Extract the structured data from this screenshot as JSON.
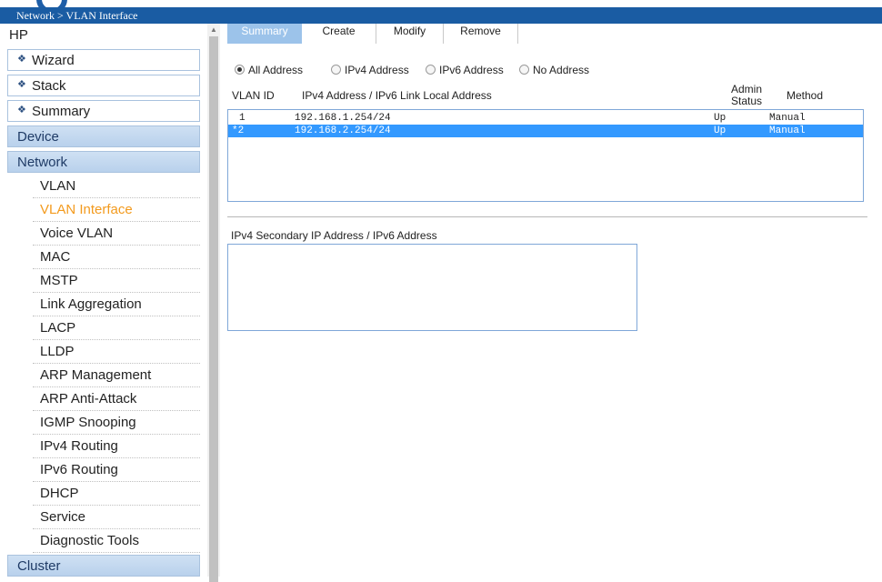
{
  "breadcrumb": "Network > VLAN Interface",
  "sidebar": {
    "root": "HP",
    "boxes": [
      {
        "label": "Wizard"
      },
      {
        "label": "Stack"
      },
      {
        "label": "Summary"
      }
    ],
    "categories": {
      "device": "Device",
      "network": "Network",
      "cluster": "Cluster"
    },
    "network_items": [
      "VLAN",
      "VLAN Interface",
      "Voice VLAN",
      "MAC",
      "MSTP",
      "Link Aggregation",
      "LACP",
      "LLDP",
      "ARP Management",
      "ARP Anti-Attack",
      "IGMP Snooping",
      "IPv4 Routing",
      "IPv6 Routing",
      "DHCP",
      "Service",
      "Diagnostic Tools"
    ],
    "active_item": "VLAN Interface"
  },
  "tabs": [
    "Summary",
    "Create",
    "Modify",
    "Remove"
  ],
  "active_tab": "Summary",
  "filters": {
    "options": [
      "All Address",
      "IPv4 Address",
      "IPv6 Address",
      "No Address"
    ],
    "selected": "All Address"
  },
  "table": {
    "columns": {
      "vlan_id": "VLAN ID",
      "address": "IPv4 Address / IPv6 Link Local Address",
      "admin_line1": "Admin",
      "admin_line2": "Status",
      "method": "Method"
    },
    "rows": [
      {
        "vlan": "1",
        "address": "192.168.1.254/24",
        "status": "Up",
        "method": "Manual",
        "selected": false
      },
      {
        "vlan": "*2",
        "address": "192.168.2.254/24",
        "status": "Up",
        "method": "Manual",
        "selected": true
      }
    ]
  },
  "secondary_section": {
    "label": "IPv4 Secondary IP Address / IPv6 Address"
  },
  "colors": {
    "header_blue": "#1a5ca3",
    "active_tab": "#9cc3ea",
    "selected_row": "#3399ff",
    "active_menu": "#f39a1d"
  }
}
